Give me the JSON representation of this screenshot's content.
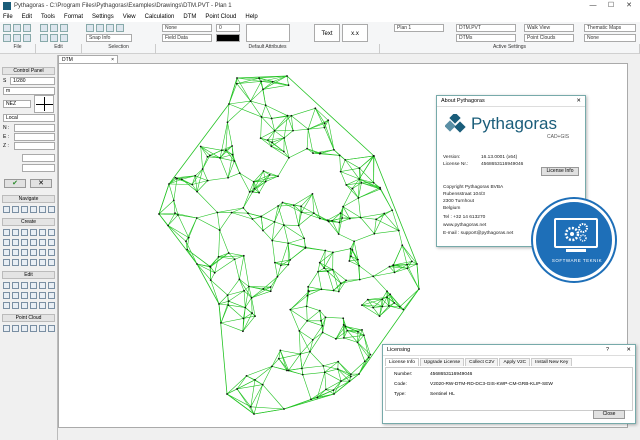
{
  "window": {
    "title": "Pythagoras - C:\\Program Files\\Pythagoras\\Examples\\Drawings\\DTM.PVT - Plan 1",
    "minimize": "—",
    "maximize": "☐",
    "close": "✕"
  },
  "menu": [
    "File",
    "Edit",
    "Tools",
    "Format",
    "Settings",
    "View",
    "Calculation",
    "DTM",
    "Point Cloud",
    "Help"
  ],
  "toolbar": {
    "snap_info": "Snap Info",
    "layer_none": "None",
    "field_data": "Field Data",
    "line_weight": "0",
    "text_button": "Text",
    "xx_button": "x.x",
    "plan": "Plan 1",
    "dtm_file": "DTM.PVT",
    "dtms": "DTMs",
    "walk_view": "Walk View",
    "point_clouds": "Point Clouds",
    "thematic_maps": "Thematic Maps",
    "none2": "None",
    "groups": [
      "File",
      "Edit",
      "Selection",
      "Default Attributes",
      "Active Settings"
    ]
  },
  "doc_tab": "DTM",
  "left_panel": {
    "control_panel": "Control Panel",
    "scale_label": "S",
    "scale_value": "1/280",
    "unit": "m",
    "nez": "NEZ",
    "local": "Local",
    "n_label": "N :",
    "e_label": "E :",
    "z_label": "Z :",
    "ok_symbol": "✔",
    "cancel_symbol": "✕",
    "navigate": "Navigate",
    "create": "Create",
    "edit": "Edit",
    "point_cloud": "Point Cloud"
  },
  "about": {
    "title": "About Pythagoras",
    "logo_text": "Pythagoras",
    "logo_sub": "CAD+GIS",
    "version_label": "Version:",
    "version": "16.13.0001 (x64)",
    "license_label": "License Nr.:",
    "license": "4568653116949046",
    "license_info_button": "License Info",
    "company": "Copyright Pythagoras BVBA",
    "street": "Rubensstraat 104/3",
    "city": "2300 Turnhout",
    "country": "Belgium",
    "tel": "Tel      : +32 14 613270",
    "web": "www.pythagoras.net",
    "email": "E-mail : support@pythagoras.net"
  },
  "licensing": {
    "title": "Licensing",
    "help": "?",
    "tabs": [
      "License Info",
      "Upgrade License",
      "Collect C2V",
      "Apply V2C",
      "Install New Key"
    ],
    "number_label": "Number:",
    "number": "4568653116949046",
    "code_label": "Code:",
    "code": "V2020-RW-DTM-RD-DC3-GIS-KWP-CM-GRB-KLIP-SEW",
    "type_label": "Type:",
    "type": "Sentinel HL",
    "close_button": "Close"
  },
  "badge": {
    "text": "SOFTWARE TEKNIK"
  },
  "colors": {
    "mesh": "#22c322",
    "point": "#101010",
    "accent": "#1e6fb8",
    "logo_teal": "#1a5d7a"
  }
}
